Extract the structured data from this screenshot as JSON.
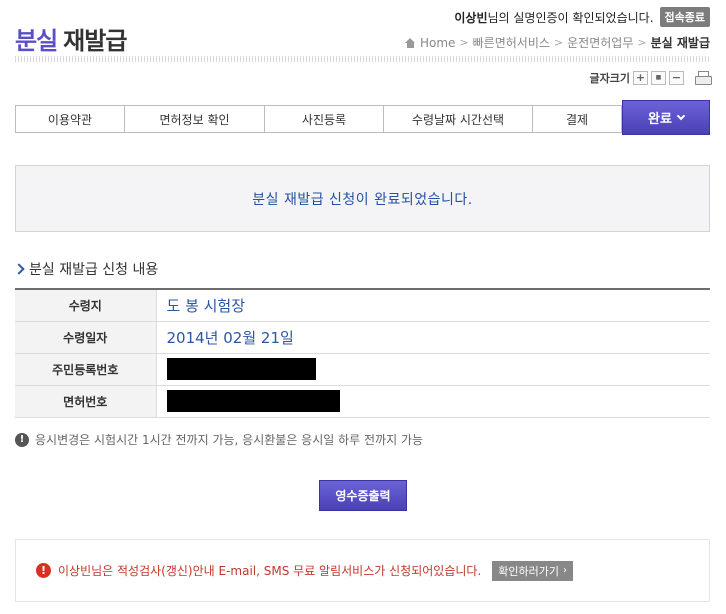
{
  "header": {
    "user_name": "이상빈",
    "status_text": "님의 실명인증이 확인되었습니다.",
    "logout_label": "접속종료",
    "title_highlight": "분실",
    "title_rest": "재발급"
  },
  "breadcrumb": {
    "home": "Home",
    "items": [
      "빠른면허서비스",
      "운전면허업무"
    ],
    "current": "분실 재발급",
    "separator": ">"
  },
  "font_size": {
    "label": "글자크기",
    "plus": "+",
    "default": "■",
    "minus": "−"
  },
  "steps": {
    "items": [
      "이용약관",
      "면허정보 확인",
      "사진등록",
      "수령날짜 시간선택",
      "결제"
    ],
    "active": "완료"
  },
  "completion_message": "분실 재발급 신청이 완료되었습니다.",
  "section_title": "분실 재발급 신청 내용",
  "details": {
    "rows": [
      {
        "label": "수령지",
        "value": "도 봉 시험장"
      },
      {
        "label": "수령일자",
        "value": "2014년 02월 21일"
      },
      {
        "label": "주민등록번호",
        "value": ""
      },
      {
        "label": "면허번호",
        "value": ""
      }
    ]
  },
  "notice": {
    "icon_text": "!",
    "text": "응시변경은 시험시간 1시간 전까지 가능, 응시환불은 응시일 하루 전까지 가능"
  },
  "receipt_button": "영수증출력",
  "alert": {
    "icon_text": "!",
    "text": "이상빈님은 적성검사(갱신)안내 E-mail, SMS 무료 알림서비스가 신청되어있습니다.",
    "button_label": "확인하러가기",
    "button_arrow": "›"
  },
  "colors": {
    "accent": "#4a40b8",
    "link_blue": "#2451a3",
    "alert_red": "#c0392b"
  }
}
